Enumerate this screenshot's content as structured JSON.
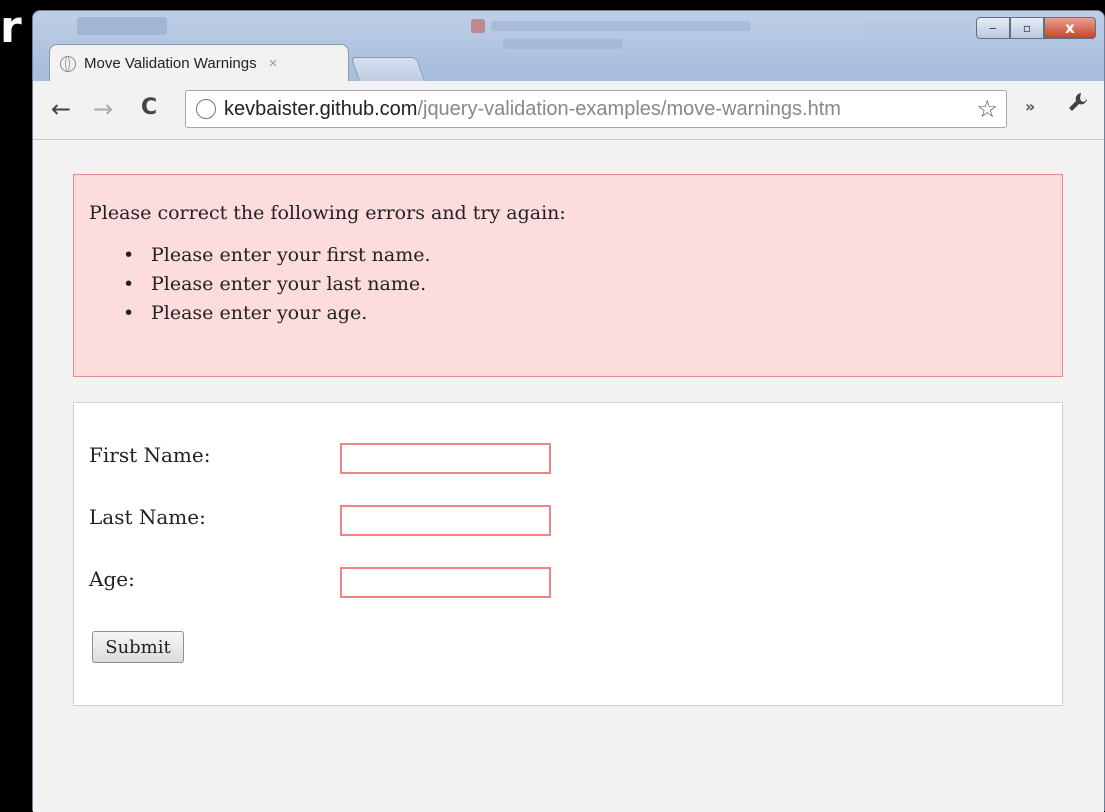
{
  "edge_letter": "r",
  "browser": {
    "tab_title": "Move Validation Warnings",
    "tab_close": "×",
    "url_host": "kevbaister.github.com",
    "url_path": "/jquery-validation-examples/move-warnings.htm",
    "back_icon": "←",
    "forward_icon": "→",
    "reload_icon": "C",
    "star_icon": "☆",
    "more_icon": "»",
    "wrench_icon": "🔧",
    "minimize_icon": "‒",
    "maximize_icon": "▫",
    "close_icon": "x"
  },
  "errors": {
    "heading": "Please correct the following errors and try again:",
    "items": [
      "Please enter your first name.",
      "Please enter your last name.",
      "Please enter your age."
    ]
  },
  "form": {
    "first_name_label": "First Name:",
    "last_name_label": "Last Name:",
    "age_label": "Age:",
    "first_name_value": "",
    "last_name_value": "",
    "age_value": "",
    "submit_label": "Submit"
  },
  "colors": {
    "error_bg": "#fcdcdc",
    "error_border": "#e98a8a",
    "field_error_border": "#ee8585"
  }
}
